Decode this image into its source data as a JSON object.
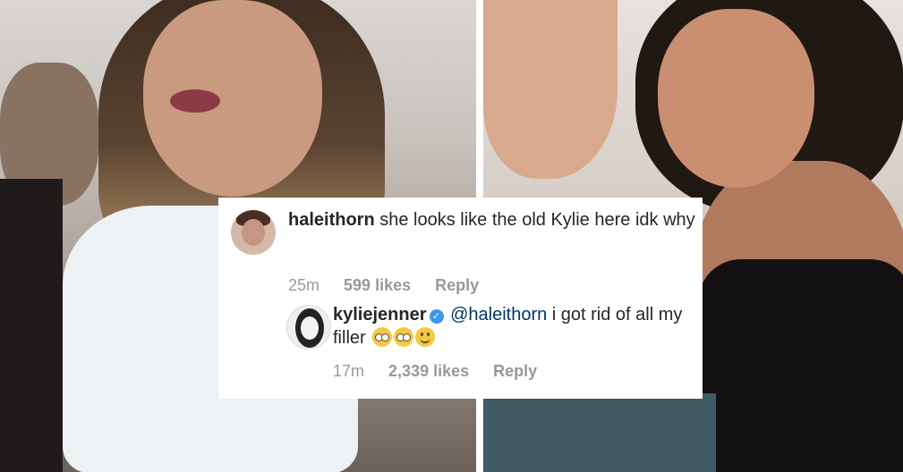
{
  "comments": [
    {
      "username": "haleithorn",
      "text": " she looks like the old Kylie here idk why",
      "time": "25m",
      "likes": "599 likes",
      "reply": "Reply"
    },
    {
      "username": "kyliejenner",
      "verified": true,
      "mention": "@haleithorn",
      "text": " i got rid of all my filler",
      "emojis": [
        "flushed-face",
        "flushed-face",
        "slightly-smiling-face"
      ],
      "time": "17m",
      "likes": "2,339 likes",
      "reply": "Reply"
    }
  ],
  "colors": {
    "text": "#262626",
    "mention": "#003569",
    "meta": "#999999",
    "verified_badge": "#3897f0"
  }
}
